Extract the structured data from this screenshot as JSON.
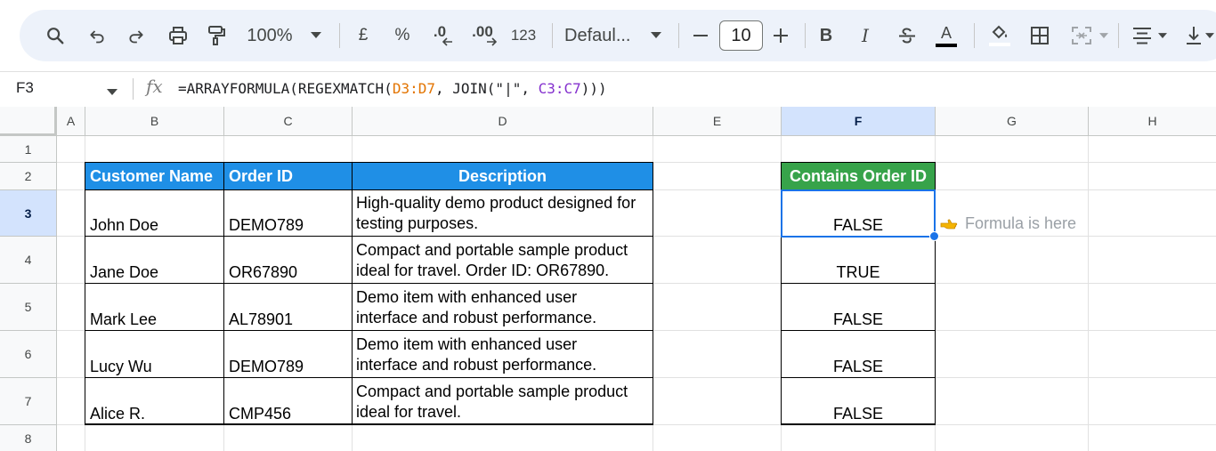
{
  "toolbar": {
    "zoom": "100%",
    "currency": "£",
    "percent": "%",
    "decrease_decimal": ".0",
    "increase_decimal": ".00",
    "number_format": "123",
    "font": "Defaul...",
    "font_size": "10",
    "bold": "B",
    "italic": "I",
    "text_color_glyph": "A",
    "icons": [
      "search-icon",
      "undo-icon",
      "redo-icon",
      "print-icon",
      "paint-format-icon",
      "chevron-down-icon",
      "minus-icon",
      "plus-icon",
      "bold-icon",
      "italic-icon",
      "strikethrough-icon",
      "text-color-icon",
      "fill-color-icon",
      "borders-icon",
      "merge-cells-icon",
      "align-icon",
      "vertical-align-icon"
    ]
  },
  "formula_bar": {
    "cell_ref": "F3",
    "fx": "fx",
    "formula_prefix": "=ARRAYFORMULA(REGEXMATCH(",
    "range1": "D3:D7",
    "formula_mid": ", JOIN(\"|\", ",
    "range2": "C3:C7",
    "formula_suffix": ")))"
  },
  "columns": [
    "A",
    "B",
    "C",
    "D",
    "E",
    "F",
    "G",
    "H"
  ],
  "rows": [
    "1",
    "2",
    "3",
    "4",
    "5",
    "6",
    "7",
    "8"
  ],
  "table": {
    "headers": {
      "customer_name": "Customer Name",
      "order_id": "Order ID",
      "description": "Description",
      "contains": "Contains Order ID"
    },
    "rows": [
      {
        "name": "John Doe",
        "order_id": "DEMO789",
        "desc1": "High-quality demo product designed for",
        "desc2": "testing purposes.",
        "result": "FALSE"
      },
      {
        "name": "Jane Doe",
        "order_id": "OR67890",
        "desc1": "Compact and portable sample product",
        "desc2": "ideal for travel. Order ID: OR67890.",
        "result": "TRUE"
      },
      {
        "name": "Mark Lee",
        "order_id": "AL78901",
        "desc1": "Demo item with enhanced user",
        "desc2": "interface and robust performance.",
        "result": "FALSE"
      },
      {
        "name": "Lucy Wu",
        "order_id": "DEMO789",
        "desc1": "Demo item with enhanced user",
        "desc2": "interface and robust performance.",
        "result": "FALSE"
      },
      {
        "name": "Alice R.",
        "order_id": "CMP456",
        "desc1": "Compact and portable sample product",
        "desc2": "ideal for travel.",
        "result": "FALSE"
      }
    ]
  },
  "annotation": "Formula is here",
  "colors": {
    "header_blue": "#1f8fe6",
    "header_green": "#37a34a",
    "selection": "#1a73e8",
    "range_orange": "#e37400",
    "range_purple": "#8430ce",
    "hand_icon": "#f4b400"
  }
}
